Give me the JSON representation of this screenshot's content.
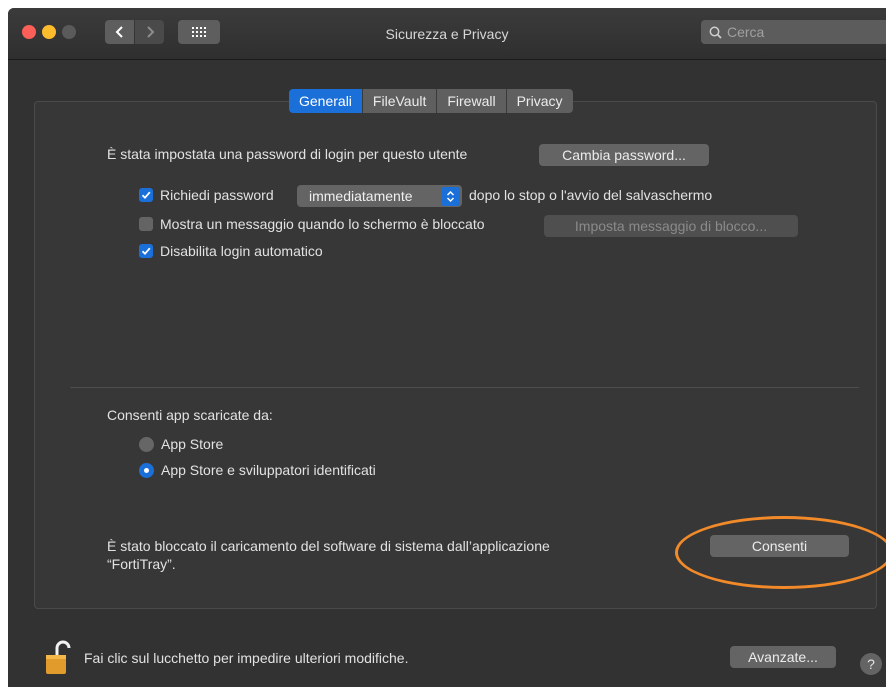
{
  "window": {
    "title": "Sicurezza e Privacy"
  },
  "toolbar": {
    "search_placeholder": "Cerca"
  },
  "tabs": [
    {
      "label": "Generali",
      "active": true
    },
    {
      "label": "FileVault",
      "active": false
    },
    {
      "label": "Firewall",
      "active": false
    },
    {
      "label": "Privacy",
      "active": false
    }
  ],
  "general": {
    "password_set_text": "È stata impostata una password di login per questo utente",
    "change_password_button": "Cambia password...",
    "require_password": {
      "label": "Richiedi password",
      "checked": true
    },
    "require_password_popup_value": "immediatamente",
    "require_password_suffix": "dopo lo stop o l'avvio del salvaschermo",
    "show_message": {
      "label": "Mostra un messaggio quando lo schermo è bloccato",
      "checked": false
    },
    "set_lock_message_button": "Imposta messaggio di blocco...",
    "disable_autologin": {
      "label": "Disabilita login automatico",
      "checked": true
    }
  },
  "downloads": {
    "heading": "Consenti app scaricate da:",
    "options": [
      {
        "label": "App Store",
        "selected": false
      },
      {
        "label": "App Store e sviluppatori identificati",
        "selected": true
      }
    ]
  },
  "blocked": {
    "text_line1": "È stato bloccato il caricamento del software di sistema dall’applicazione",
    "text_line2": "“FortiTray”.",
    "allow_button": "Consenti"
  },
  "footer": {
    "lock_text": "Fai clic sul lucchetto per impedire ulteriori modifiche.",
    "advanced_button": "Avanzate...",
    "help_button": "?"
  },
  "colors": {
    "accent": "#1b6fd9",
    "highlight": "#f28a2a"
  }
}
